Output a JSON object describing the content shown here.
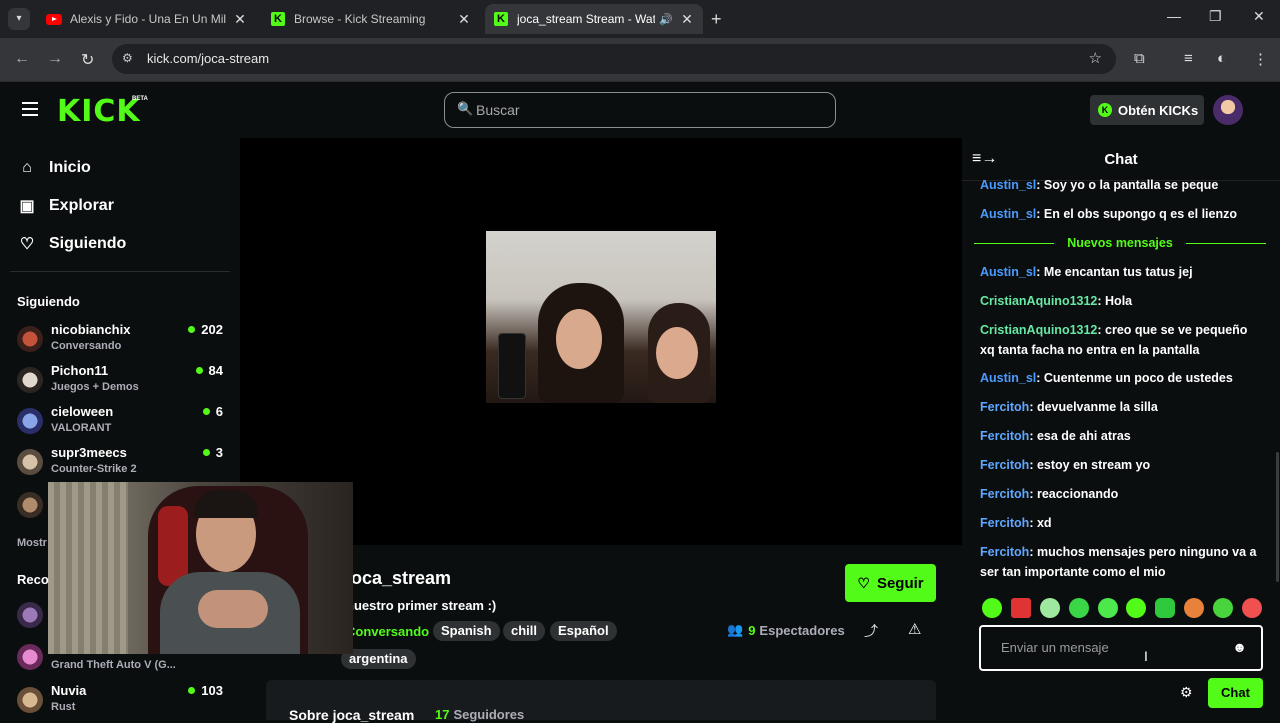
{
  "browser": {
    "tabs": [
      {
        "label": "Alexis y Fido - Una En Un Millón",
        "favicon": "youtube-icon"
      },
      {
        "label": "Browse - Kick Streaming",
        "favicon": "kick-icon"
      },
      {
        "label": "joca_stream Stream - Watch",
        "favicon": "kick-icon",
        "active": true
      }
    ],
    "url": "kick.com/joca-stream"
  },
  "header": {
    "logo": "KICK",
    "beta": "BETA",
    "search_placeholder": "Buscar",
    "kicks_button": "Obtén KICKs",
    "kicks_icon_glyph": "K"
  },
  "sidebar": {
    "nav": [
      {
        "label": "Inicio",
        "icon": "home-icon"
      },
      {
        "label": "Explorar",
        "icon": "browse-icon"
      },
      {
        "label": "Siguiendo",
        "icon": "heart-icon"
      }
    ],
    "following_title": "Siguiendo",
    "channels": [
      {
        "name": "nicobianchix",
        "category": "Conversando",
        "viewers": "202"
      },
      {
        "name": "Pichon11",
        "category": "Juegos + Demos",
        "viewers": "84"
      },
      {
        "name": "cieloween",
        "category": "VALORANT",
        "viewers": "6"
      },
      {
        "name": "supr3meecs",
        "category": "Counter-Strike 2",
        "viewers": "3"
      }
    ],
    "show_more": "Mostr",
    "recommended_title": "Reco",
    "recommended": [
      {
        "name": "",
        "category": "Grand Theft Auto V (G...",
        "viewers": ""
      },
      {
        "name": "Nuvia",
        "category": "Rust",
        "viewers": "103"
      }
    ]
  },
  "stream": {
    "title": "joca_stream",
    "subtitle": "nuestro primer stream :)",
    "category": "Conversando",
    "tags": [
      "Spanish",
      "chill",
      "Español",
      "argentina"
    ],
    "follow_label": "Seguir",
    "viewers_count": "9",
    "viewers_label": "Espectadores",
    "about_title": "Sobre joca_stream",
    "followers_count": "17",
    "followers_label": "Seguidores"
  },
  "chat": {
    "title": "Chat",
    "new_messages_label": "Nuevos mensajes",
    "messages_before": [
      {
        "user": "Austin_sl",
        "text": "Soy yo o la pantalla se peque"
      },
      {
        "user": "Austin_sl",
        "text": "En el obs supongo q es el lienzo"
      }
    ],
    "messages_after": [
      {
        "user": "Austin_sl",
        "text": "Me encantan tus tatus jej"
      },
      {
        "user": "CristianAquino1312",
        "text": "Hola"
      },
      {
        "user": "CristianAquino1312",
        "text": "creo que se ve pequeño xq tanta facha no entra en la pantalla"
      },
      {
        "user": "Austin_sl",
        "text": "Cuentenme un poco de ustedes"
      },
      {
        "user": "Ferci­toh",
        "text": "devuelvanme la silla"
      },
      {
        "user": "Fercitoh",
        "text": "esa de ahi atras"
      },
      {
        "user": "Fercitoh",
        "text": "estoy en stream yo"
      },
      {
        "user": "Fercitoh",
        "text": "reaccionando"
      },
      {
        "user": "Fercitoh",
        "text": "xd"
      },
      {
        "user": "Fercitoh",
        "text": "muchos mensajes pero ninguno va a ser tan importante como el mio"
      }
    ],
    "input_placeholder": "Enviar un mensaje",
    "send_label": "Chat"
  },
  "colors": {
    "accent": "#53fc18",
    "background": "#0b0e0f",
    "chat_user_blue": "#4b9bff",
    "chat_user_green": "#67e8a5"
  }
}
